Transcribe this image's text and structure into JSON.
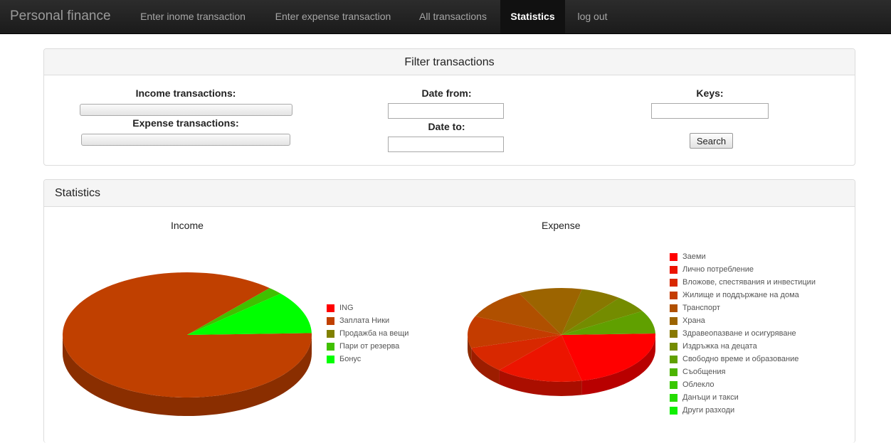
{
  "app": {
    "brand": "Personal finance"
  },
  "nav": {
    "income": "Enter inome transaction",
    "expense": "Enter expense transaction",
    "all": "All transactions",
    "statistics": "Statistics",
    "logout": "log out"
  },
  "filter": {
    "title": "Filter transactions",
    "income_label": "Income transactions:",
    "expense_label": "Expense transactions:",
    "income_value": "",
    "expense_value": "",
    "date_from_label": "Date from:",
    "date_to_label": "Date to:",
    "date_from_value": "",
    "date_to_value": "",
    "keys_label": "Keys:",
    "keys_value": "",
    "search_label": "Search"
  },
  "statistics": {
    "title": "Statistics"
  },
  "chart_data": [
    {
      "type": "pie",
      "title": "Income",
      "categories": [
        "ING",
        "Заплата Ники",
        "Продажба на вещи",
        "Пари от резерва",
        "Бонус"
      ],
      "values": [
        0,
        87,
        0,
        2,
        11
      ],
      "colors": [
        "#ff0000",
        "#c04000",
        "#808000",
        "#40c000",
        "#00ff00"
      ],
      "legend": "right",
      "style": "3d"
    },
    {
      "type": "pie",
      "title": "Expense",
      "categories": [
        "Заеми",
        "Лично потребление",
        "Вложове, спестявания и инвестиции",
        "Жилище и поддържане на дома",
        "Транспорт",
        "Храна",
        "Здравеопазване и осигуряване",
        "Издръжка на децата",
        "Свободно време и образование",
        "Съобщения",
        "Облекло",
        "Данъци и такси",
        "Други разходи"
      ],
      "values": [
        22,
        15,
        9,
        11,
        11,
        11,
        7,
        6,
        8,
        0,
        0,
        0,
        0
      ],
      "colors": [
        "#ff0000",
        "#ec1400",
        "#d82800",
        "#c43c00",
        "#b05000",
        "#9c6400",
        "#887800",
        "#748c00",
        "#60a000",
        "#4cb400",
        "#38c800",
        "#24dc00",
        "#10f000"
      ],
      "legend": "right",
      "style": "3d"
    }
  ]
}
